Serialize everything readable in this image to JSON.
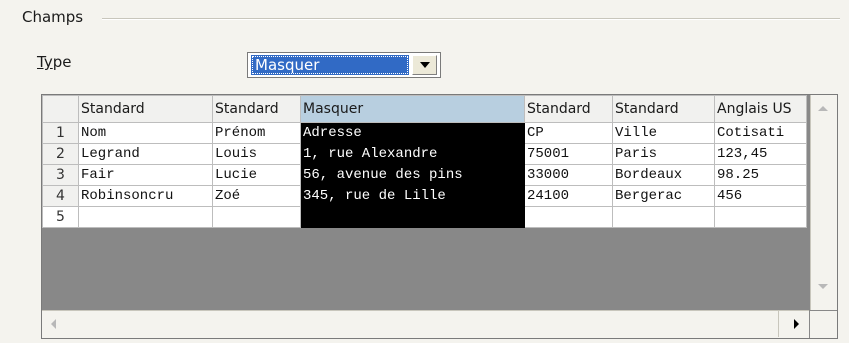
{
  "group": {
    "title": "Champs"
  },
  "type_field": {
    "label_mnemonic": "Ty",
    "label_rest": "pe",
    "selected": "Masquer"
  },
  "table": {
    "headers": [
      "Standard",
      "Standard",
      "Masquer",
      "Standard",
      "Standard",
      "Anglais US"
    ],
    "rows": [
      {
        "num": "1",
        "cells": [
          "Nom",
          "Prénom",
          "Adresse",
          "CP",
          "Ville",
          "Cotisati"
        ]
      },
      {
        "num": "2",
        "cells": [
          "Legrand",
          "Louis",
          "1, rue Alexandre",
          "75001",
          "Paris",
          "123,45"
        ]
      },
      {
        "num": "3",
        "cells": [
          "Fair",
          "Lucie",
          "56, avenue des pins",
          "33000",
          "Bordeaux",
          "98.25"
        ]
      },
      {
        "num": "4",
        "cells": [
          "Robinsoncru",
          "Zoé",
          "345, rue de Lille",
          "24100",
          "Bergerac",
          "456"
        ]
      },
      {
        "num": "5",
        "cells": [
          "",
          "",
          "",
          "",
          "",
          ""
        ]
      }
    ]
  },
  "icons": {
    "dropdown": "chevron-down-icon",
    "scroll_up": "arrow-up-icon",
    "scroll_down": "arrow-down-icon",
    "scroll_left": "arrow-left-icon",
    "scroll_right": "arrow-right-icon"
  },
  "colors": {
    "selection": "#316ac5",
    "selected_column": "#000000",
    "selected_header": "#b8cfe0"
  }
}
